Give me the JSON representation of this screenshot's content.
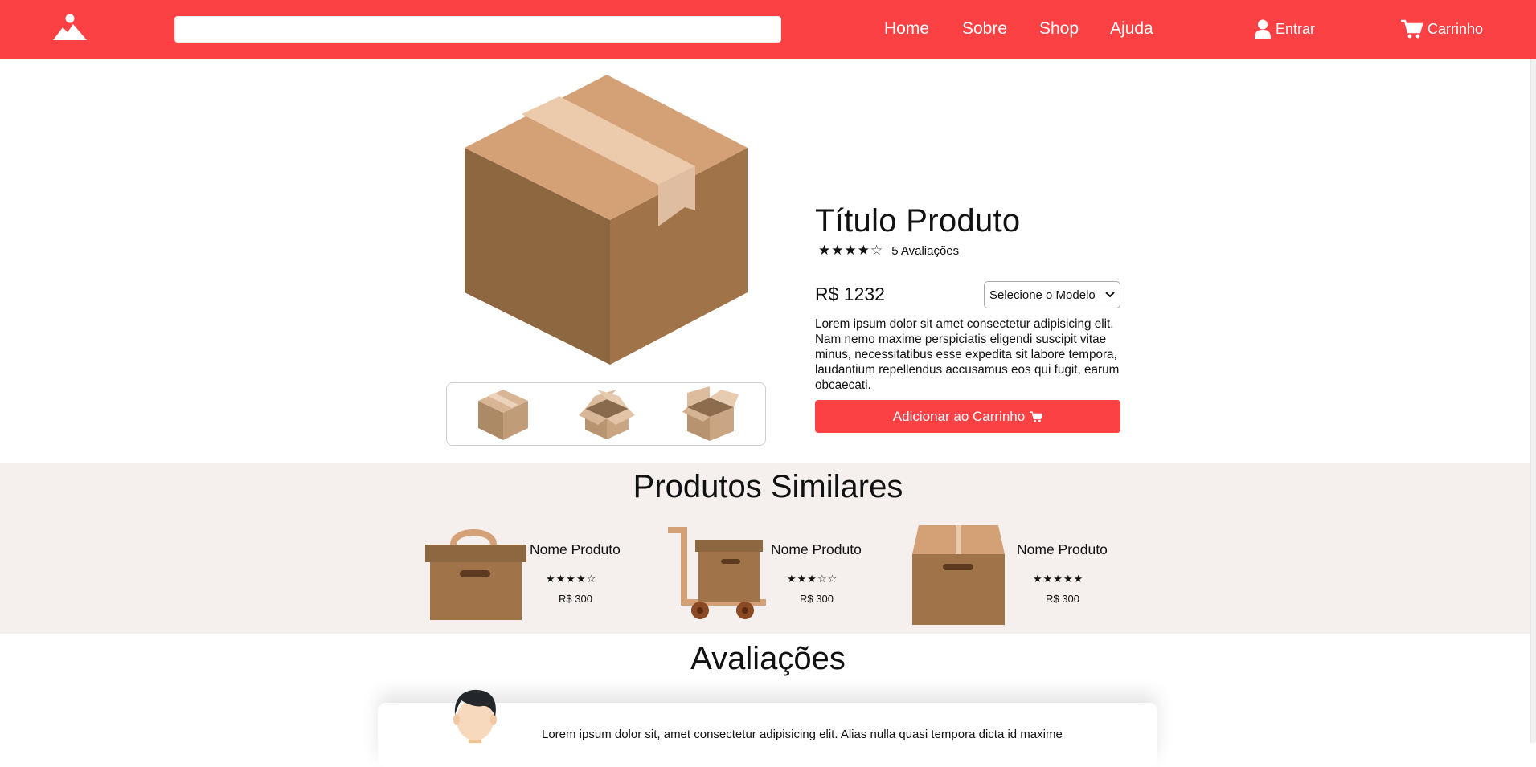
{
  "colors": {
    "brand": "#fc4144",
    "section_bg": "#f5efee"
  },
  "nav": {
    "logo_icon": "mountain-image-icon",
    "search_value": "",
    "links": [
      "Home",
      "Sobre",
      "Shop",
      "Ajuda"
    ],
    "login_label": "Entrar",
    "login_icon": "user-icon",
    "cart_label": "Carrinho",
    "cart_icon": "cart-icon"
  },
  "product": {
    "title": "Título Produto",
    "stars": "★★★★☆",
    "rating": 4,
    "reviews_label": "5 Avaliações",
    "price": "R$ 1232",
    "select_value": "Selecione o Modelo",
    "description": "Lorem ipsum dolor sit amet consectetur adipisicing elit. Nam nemo maxime perspiciatis eligendi suscipit vitae minus, necessitatibus esse expedita sit labore tempora, laudantium repellendus accusamus eos qui fugit, earum obcaecati.",
    "add_to_cart": "Adicionar ao Carrinho",
    "thumbnails": [
      "closed-box-icon",
      "open-box-icon",
      "open-box-side-icon"
    ]
  },
  "similar": {
    "title": "Produtos Similares",
    "items": [
      {
        "name": "Nome Produto",
        "stars": "★★★★☆",
        "rating": 4,
        "price": "R$ 300",
        "icon": "handle-box-icon"
      },
      {
        "name": "Nome Produto",
        "stars": "★★★☆☆",
        "rating": 3,
        "price": "R$ 300",
        "icon": "hand-truck-box-icon"
      },
      {
        "name": "Nome Produto",
        "stars": "★★★★★",
        "rating": 5,
        "price": "R$ 300",
        "icon": "cardboard-box-icon"
      }
    ]
  },
  "reviews": {
    "title": "Avaliações",
    "first_text": "Lorem ipsum dolor sit, amet consectetur adipisicing elit. Alias nulla quasi tempora dicta id maxime"
  }
}
